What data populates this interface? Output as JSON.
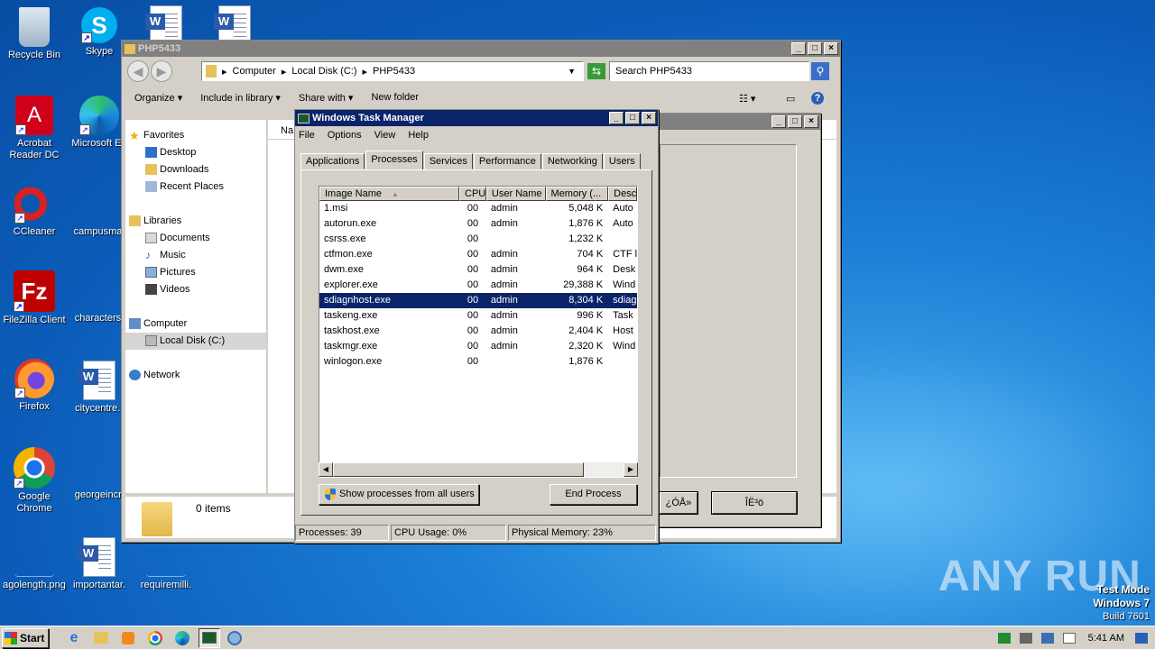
{
  "desktop": {
    "icons": [
      {
        "label": "Recycle Bin"
      },
      {
        "label": "Skype"
      },
      {
        "label": "Acrobat Reader DC"
      },
      {
        "label": "Microsoft Ed"
      },
      {
        "label": "CCleaner"
      },
      {
        "label": "campusmat"
      },
      {
        "label": "FileZilla Client"
      },
      {
        "label": "characterst"
      },
      {
        "label": "Firefox"
      },
      {
        "label": "citycentre.r"
      },
      {
        "label": "Google Chrome"
      },
      {
        "label": "georgeincr."
      },
      {
        "label": "agolength.png"
      },
      {
        "label": "importantar."
      },
      {
        "label": "requiremilli."
      }
    ],
    "watermark": "ANY RUN",
    "test_mode": {
      "line1": "Test Mode",
      "line2": "Windows 7",
      "line3": "Build 7601"
    }
  },
  "explorer": {
    "title": "PHP5433",
    "address": {
      "parts": [
        "Computer",
        "Local Disk (C:)",
        "PHP5433"
      ]
    },
    "search_placeholder": "Search PHP5433",
    "toolbar": {
      "organize": "Organize",
      "include": "Include in library",
      "share": "Share with",
      "new_folder": "New folder"
    },
    "nav": {
      "favorites": "Favorites",
      "desktop": "Desktop",
      "downloads": "Downloads",
      "recent": "Recent Places",
      "libraries": "Libraries",
      "documents": "Documents",
      "music": "Music",
      "pictures": "Pictures",
      "videos": "Videos",
      "computer": "Computer",
      "local_disk": "Local Disk (C:)",
      "network": "Network"
    },
    "column_header": "Na",
    "status": "0 items"
  },
  "dialog": {
    "btn1": "¿ÓÅ»",
    "btn2": "ÎË³ö"
  },
  "taskmgr": {
    "title": "Windows Task Manager",
    "menu": [
      "File",
      "Options",
      "View",
      "Help"
    ],
    "tabs": [
      "Applications",
      "Processes",
      "Services",
      "Performance",
      "Networking",
      "Users"
    ],
    "active_tab": "Processes",
    "columns": [
      "Image Name",
      "CPU",
      "User Name",
      "Memory (...",
      "Desc"
    ],
    "rows": [
      {
        "name": "1.msi",
        "cpu": "00",
        "user": "admin",
        "mem": "5,048 K",
        "desc": "Auto"
      },
      {
        "name": "autorun.exe",
        "cpu": "00",
        "user": "admin",
        "mem": "1,876 K",
        "desc": "Auto"
      },
      {
        "name": "csrss.exe",
        "cpu": "00",
        "user": "",
        "mem": "1,232 K",
        "desc": ""
      },
      {
        "name": "ctfmon.exe",
        "cpu": "00",
        "user": "admin",
        "mem": "704 K",
        "desc": "CTF l"
      },
      {
        "name": "dwm.exe",
        "cpu": "00",
        "user": "admin",
        "mem": "964 K",
        "desc": "Desk"
      },
      {
        "name": "explorer.exe",
        "cpu": "00",
        "user": "admin",
        "mem": "29,388 K",
        "desc": "Wind"
      },
      {
        "name": "sdiagnhost.exe",
        "cpu": "00",
        "user": "admin",
        "mem": "8,304 K",
        "desc": "sdiag"
      },
      {
        "name": "taskeng.exe",
        "cpu": "00",
        "user": "admin",
        "mem": "996 K",
        "desc": "Task"
      },
      {
        "name": "taskhost.exe",
        "cpu": "00",
        "user": "admin",
        "mem": "2,404 K",
        "desc": "Host"
      },
      {
        "name": "taskmgr.exe",
        "cpu": "00",
        "user": "admin",
        "mem": "2,320 K",
        "desc": "Wind"
      },
      {
        "name": "winlogon.exe",
        "cpu": "00",
        "user": "",
        "mem": "1,876 K",
        "desc": ""
      }
    ],
    "selected_row": 6,
    "show_all_button": "Show processes from all users",
    "end_process_button": "End Process",
    "status": {
      "processes": "Processes: 39",
      "cpu": "CPU Usage: 0%",
      "memory": "Physical Memory: 23%"
    }
  },
  "taskbar": {
    "start": "Start",
    "clock": "5:41 AM"
  },
  "colors": {
    "title_active": "#0a246a",
    "selection": "#0a246a",
    "face": "#d4d0c8"
  }
}
